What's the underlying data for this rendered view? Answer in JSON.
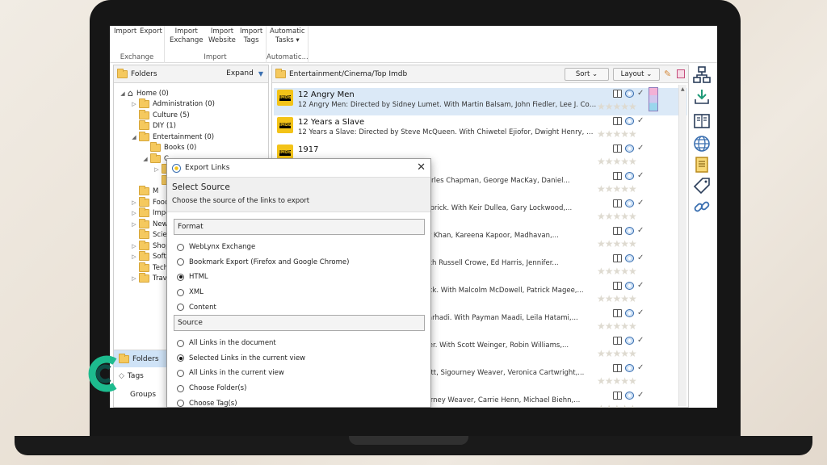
{
  "ribbon": {
    "import_label": "Import",
    "export_label": "Export",
    "exchange_group": "Exchange",
    "import_exchange": [
      "Import",
      "Exchange"
    ],
    "import_website": [
      "Import",
      "Website"
    ],
    "import_tags": [
      "Import",
      "Tags"
    ],
    "import_group": "Import",
    "automatic_tasks": [
      "Automatic",
      "Tasks ▾"
    ],
    "automatic_group": "Automatic..."
  },
  "left_panel": {
    "title": "Folders",
    "expand_label": "Expand",
    "tree": [
      {
        "label": "Home (0)",
        "toggle": "◢"
      },
      {
        "label": "Administration (0)",
        "toggle": "▷"
      },
      {
        "label": "Culture (5)",
        "toggle": ""
      },
      {
        "label": "DIY (1)",
        "toggle": ""
      },
      {
        "label": "Entertainment (0)",
        "toggle": "◢"
      },
      {
        "label": "Books (0)",
        "toggle": ""
      },
      {
        "label": "C",
        "toggle": "◢"
      },
      {
        "label": "",
        "toggle": "▷"
      },
      {
        "label": "",
        "toggle": ""
      },
      {
        "label": "M",
        "toggle": ""
      },
      {
        "label": "Food",
        "toggle": "▷"
      },
      {
        "label": "Impo",
        "toggle": "▷"
      },
      {
        "label": "News",
        "toggle": "▷"
      },
      {
        "label": "Scien",
        "toggle": ""
      },
      {
        "label": "Shop",
        "toggle": "▷"
      },
      {
        "label": "Softw",
        "toggle": "▷"
      },
      {
        "label": "Techn",
        "toggle": ""
      },
      {
        "label": "Trave",
        "toggle": "▷"
      }
    ],
    "tabs": [
      "Folders",
      "Tags",
      "Groups"
    ]
  },
  "main_panel": {
    "path": "Entertainment/Cinema/Top Imdb",
    "sort_label": "Sort ⌄",
    "layout_label": "Layout ⌄",
    "rows": [
      {
        "title": "12 Angry Men",
        "desc": "12 Angry Men: Directed by Sidney Lumet. With Martin Balsam, John Fiedler, Lee J. Cobb,..."
      },
      {
        "title": "12 Years a Slave",
        "desc": "12 Years a Slave: Directed by Steve McQueen. With Chiwetel Ejiofor, Dwight Henry, Dickie..."
      },
      {
        "title": "1917",
        "desc": ""
      },
      {
        "title": "",
        "desc": "n-Charles Chapman, George MacKay, Daniel..."
      },
      {
        "title": "",
        "desc": "ey Kubrick. With Keir Dullea, Gary Lockwood,..."
      },
      {
        "title": "",
        "desc": "Aamir Khan, Kareena Kapoor, Madhavan,..."
      },
      {
        "title": "",
        "desc": "tt. With Russell Crowe, Ed Harris, Jennifer..."
      },
      {
        "title": "",
        "desc": "Kubrick. With Malcolm McDowell, Patrick Magee,..."
      },
      {
        "title": "",
        "desc": "har Farhadi. With Payman Maadi, Leila Hatami,..."
      },
      {
        "title": "",
        "desc": "Musker. With Scott Weinger, Robin Williams,..."
      },
      {
        "title": "",
        "desc": "Skerritt, Sigourney Weaver, Veronica Cartwright,..."
      },
      {
        "title": "",
        "desc": "Sigourney Weaver, Carrie Henn, Michael Biehn,..."
      },
      {
        "title": "",
        "desc": ""
      }
    ],
    "imdb_badge": "IMDb",
    "check": "✓",
    "stars": "★★★★★"
  },
  "dialog": {
    "title": "Export Links",
    "close": "✕",
    "heading": "Select Source",
    "subheading": "Choose the source of the links to export",
    "format_label": "Format",
    "format_options": [
      {
        "label": "WebLynx Exchange",
        "selected": false
      },
      {
        "label": "Bookmark Export (Firefox and Google Chrome)",
        "selected": false
      },
      {
        "label": "HTML",
        "selected": true
      },
      {
        "label": "XML",
        "selected": false
      },
      {
        "label": "Content",
        "selected": false
      }
    ],
    "source_label": "Source",
    "source_options": [
      {
        "label": "All Links in the document",
        "selected": false
      },
      {
        "label": "Selected Links in the current view",
        "selected": true
      },
      {
        "label": "All Links in the current view",
        "selected": false
      },
      {
        "label": "Choose Folder(s)",
        "selected": false
      },
      {
        "label": "Choose Tag(s)",
        "selected": false
      }
    ]
  },
  "colors": {
    "accent": "#3a6fb0",
    "folder": "#f5c95e",
    "imdb": "#f3c318",
    "logo": "#1dbb8e"
  }
}
